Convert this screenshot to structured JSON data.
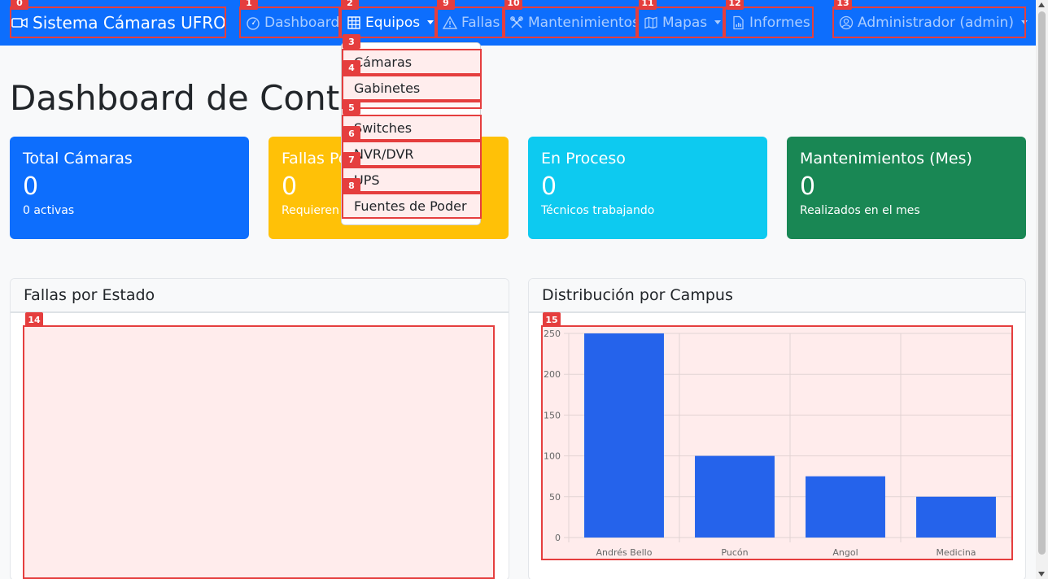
{
  "navbar": {
    "brand": "Sistema Cámaras UFRO",
    "items": [
      {
        "label": "Dashboard"
      },
      {
        "label": "Equipos"
      },
      {
        "label": "Fallas"
      },
      {
        "label": "Mantenimientos"
      },
      {
        "label": "Mapas"
      },
      {
        "label": "Informes"
      }
    ],
    "user": "Administrador (admin)"
  },
  "dropdown": {
    "items": [
      "Cámaras",
      "Gabinetes",
      "Switches",
      "NVR/DVR",
      "UPS",
      "Fuentes de Poder"
    ]
  },
  "badges": [
    "0",
    "1",
    "2",
    "3",
    "4",
    "5",
    "6",
    "7",
    "8",
    "9",
    "10",
    "11",
    "12",
    "13",
    "14",
    "15"
  ],
  "page": {
    "title": "Dashboard de Control"
  },
  "cards": [
    {
      "title": "Total Cámaras",
      "value": "0",
      "sub": "0 activas",
      "color": "#0d6efd"
    },
    {
      "title": "Fallas Pendientes",
      "value": "0",
      "sub": "Requieren atención",
      "color": "#ffc107"
    },
    {
      "title": "En Proceso",
      "value": "0",
      "sub": "Técnicos trabajando",
      "color": "#0dcaf0"
    },
    {
      "title": "Mantenimientos (Mes)",
      "value": "0",
      "sub": "Realizados en el mes",
      "color": "#198754"
    }
  ],
  "panels": {
    "fallas": {
      "title": "Fallas por Estado"
    },
    "campus": {
      "title": "Distribución por Campus"
    }
  },
  "colors": {
    "primary": "#0d6efd",
    "bar": "#2563eb",
    "highlight": "#e53e3e"
  },
  "chart_data": {
    "type": "bar",
    "categories": [
      "Andrés Bello",
      "Pucón",
      "Angol",
      "Medicina"
    ],
    "values": [
      250,
      100,
      75,
      50
    ],
    "ylim": [
      0,
      250
    ],
    "yticks": [
      0,
      50,
      100,
      150,
      200,
      250
    ],
    "grid": true,
    "legend": "none"
  }
}
